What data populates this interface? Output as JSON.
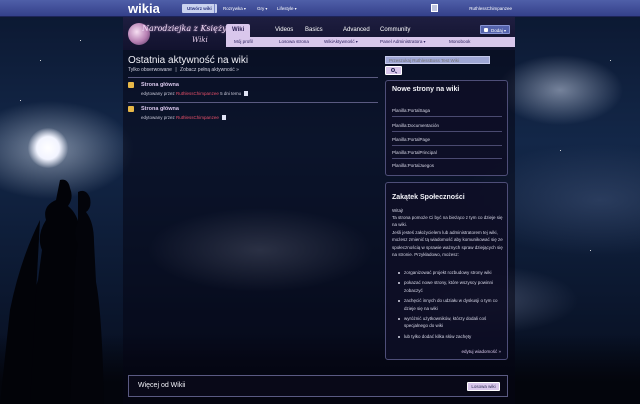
{
  "global_bar": {
    "logo": "wikia",
    "start_wiki": "Utwórz wiki",
    "menus": [
      "Rozrywka",
      "Gry",
      "Lifestyle"
    ],
    "username": "RuthlessChimpanzee"
  },
  "wiki_header": {
    "wordmark_line1": "Narodziejka z Księżyca",
    "wordmark_line2": "Wiki",
    "tabs": [
      "Wiki",
      "Videos",
      "Basics",
      "Advanced",
      "Community"
    ],
    "active_tab_index": 0,
    "subnav": [
      "Mój profil",
      "Losowa strona",
      "WikiAktywność",
      "Panel Administratora",
      "Monobook"
    ],
    "create_button": "Dodaj"
  },
  "main": {
    "title": "Ostatnia aktywność na wiki",
    "filter_watched": "Tylko obserwowane",
    "filter_all": "Zobacz pełną aktywność",
    "filter_separator": "|",
    "feed": [
      {
        "title": "Strona główna",
        "meta_prefix": "edytowany przez",
        "user": "RuthlessChimpanzee",
        "time": "5 dni temu"
      },
      {
        "title": "Strona główna",
        "meta_prefix": "edytowany przez",
        "user": "RuthlessChimpanzee",
        "time": ""
      }
    ]
  },
  "rail": {
    "search_placeholder": "Przeszukaj RuthlessBoss Test Wiki",
    "new_pages": {
      "title": "Nowe strony na wiki",
      "items": [
        "Planilla:PortalSaga",
        "Planilla:Documentación",
        "Planilla:PortalPage",
        "Planilla:PortalPrincipal",
        "Planilla:PortalJuegos"
      ]
    },
    "community_corner": {
      "title": "Zakątek Społeczności",
      "greeting": "Witaj!",
      "intro": "Ta strona pomoże Ci być na bieżąco z tym co dzieje się na wiki.",
      "admin_note": "Jeśli jesteś założycielem lub administratorem tej wiki, możesz zmienić tą wiadomość aby komunikować się ze społecznością w sprawie ważnych spraw dziejących się na stronie. Przykładowo, możesz:",
      "list": [
        "zorganizować projekt rozbudowy strony wiki",
        "pokazać nowe strony, które wszyscy powinni zobaczyć",
        "zachęcić innych do udziału w dyskusji o tym co dzieje się na wiki",
        "wyróżnić użytkowników, którzy dodali coś specjalnego do wiki",
        "lub tylko dodać kilka słów zachęty"
      ],
      "edit_link": "edytuj wiadomość »"
    }
  },
  "footer": {
    "more_title": "Więcej od Wikii",
    "random_button": "Losowa wiki"
  }
}
